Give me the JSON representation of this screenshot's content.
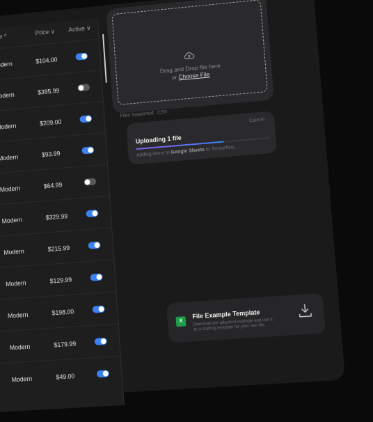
{
  "table": {
    "columns": {
      "style": "Style ^",
      "price": "Price ∨",
      "active": "Active ∨"
    },
    "rows": [
      {
        "style": "Modern",
        "price": "$104.00",
        "active": true
      },
      {
        "style": "Modern",
        "price": "$395.99",
        "active": false
      },
      {
        "style": "Modern",
        "price": "$209.00",
        "active": true
      },
      {
        "style": "Modern",
        "price": "$93.99",
        "active": true
      },
      {
        "style": "Modern",
        "price": "$64.99",
        "active": false
      },
      {
        "style": "Modern",
        "price": "$329.99",
        "active": true
      },
      {
        "style": "Modern",
        "price": "$215.99",
        "active": true
      },
      {
        "style": "Modern",
        "price": "$129.99",
        "active": true
      },
      {
        "style": "Modern",
        "price": "$198.00",
        "active": true
      },
      {
        "style": "Modern",
        "price": "$179.99",
        "active": true
      },
      {
        "style": "Modern",
        "price": "$49.00",
        "active": true
      }
    ]
  },
  "upload": {
    "line1": "Drag and Drop file here",
    "line2_prefix": "or ",
    "link": "Choose File",
    "supported": "Files Supported: .CSV",
    "cloud_icon": "cloud-upload-icon"
  },
  "progress": {
    "title": "Uploading 1 file",
    "cancel": "Cancel",
    "sub_prefix": "Adding items to ",
    "sub_bold": "Google Sheets",
    "sub_suffix": " to Tensorflow ...",
    "percent": 0.66,
    "gradient_start": "#8b5cf6",
    "gradient_end": "#3b82f6"
  },
  "template": {
    "title": "File Example Template",
    "desc": "Download the attached example and use it as a starting template for your own file.",
    "xls_label": "X",
    "download_icon": "download-icon"
  },
  "colors": {
    "accent": "#3b82f6",
    "excel": "#1f9e4a"
  }
}
